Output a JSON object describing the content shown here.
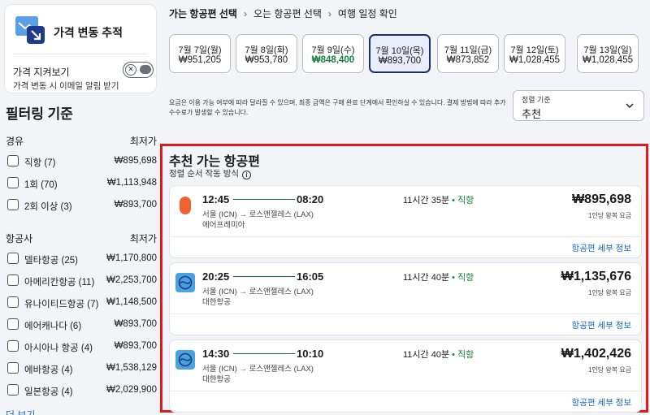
{
  "alert": {
    "title": "가격 변동 추적",
    "watch_label": "가격 지켜보기",
    "watch_sub": "가격 변동 시 이메일 알림 받기",
    "toggle_symbol": "✕"
  },
  "filters": {
    "title": "필터링 기준",
    "stops": {
      "heading": "경유",
      "price_heading": "최저가",
      "options": [
        {
          "label": "직항 (7)",
          "price": "₩895,698"
        },
        {
          "label": "1회 (70)",
          "price": "₩1,113,948"
        },
        {
          "label": "2회 이상 (3)",
          "price": "₩893,700"
        }
      ]
    },
    "airlines": {
      "heading": "항공사",
      "price_heading": "최저가",
      "options": [
        {
          "label": "델타항공 (25)",
          "price": "₩1,170,800"
        },
        {
          "label": "아메리칸항공 (11)",
          "price": "₩2,253,700"
        },
        {
          "label": "유나이티드항공 (7)",
          "price": "₩1,148,500"
        },
        {
          "label": "에어캐나다 (6)",
          "price": "₩893,700"
        },
        {
          "label": "아시아나 항공 (4)",
          "price": "₩893,700"
        },
        {
          "label": "에바항공 (4)",
          "price": "₩1,538,129"
        },
        {
          "label": "일본항공 (4)",
          "price": "₩2,029,900"
        }
      ]
    },
    "more": "더 보기"
  },
  "breadcrumb": {
    "step1": "가는 항공편 선택",
    "step2": "오는 항공편 선택",
    "step3": "여행 일정 확인",
    "sep": "›"
  },
  "dates": [
    {
      "date": "7월 7일(월)",
      "price": "₩951,205"
    },
    {
      "date": "7월 8일(화)",
      "price": "₩953,780"
    },
    {
      "date": "7월 9일(수)",
      "price": "₩848,400"
    },
    {
      "date": "7월 10일(목)",
      "price": "₩893,700"
    },
    {
      "date": "7월 11일(금)",
      "price": "₩873,852"
    },
    {
      "date": "7월 12일(토)",
      "price": "₩1,028,455"
    },
    {
      "date": "7월 13일(일)",
      "price": "₩1,028,455"
    }
  ],
  "notice": "요금은 이용 가능 여부에 따라 달라질 수 있으며, 최종 금액은 구매 완료 단계에서 확인하실 수 있습니다. 결제 방법에 따라 추가 수수료가 발생할 수 있습니다.",
  "sort": {
    "label": "정렬 기준",
    "value": "추천"
  },
  "results": {
    "title": "추천 가는 항공편",
    "howto": "정렬 순서 작동 방식",
    "flights": [
      {
        "dep": "12:45",
        "arr": "08:20",
        "route": "서울 (ICN) → 로스앤젤레스 (LAX)",
        "airline": "에어프레미아",
        "duration": "11시간 35분",
        "bullet": "•",
        "stops": "직항",
        "price": "₩895,698",
        "note": "1인당 왕복 요금",
        "detail": "항공편 세부 정보",
        "logo": "air-premia-logo",
        "color": "#f0622f"
      },
      {
        "dep": "20:25",
        "arr": "16:05",
        "route": "서울 (ICN) → 로스앤젤레스 (LAX)",
        "airline": "대한항공",
        "duration": "11시간 40분",
        "bullet": "•",
        "stops": "직항",
        "price": "₩1,135,676",
        "note": "1인당 왕복 요금",
        "detail": "항공편 세부 정보",
        "logo": "korean-air-logo",
        "color": "#4aa3dc"
      },
      {
        "dep": "14:30",
        "arr": "10:10",
        "route": "서울 (ICN) → 로스앤젤레스 (LAX)",
        "airline": "대한항공",
        "duration": "11시간 40분",
        "bullet": "•",
        "stops": "직항",
        "price": "₩1,402,426",
        "note": "1인당 왕복 요금",
        "detail": "항공편 세부 정보",
        "logo": "korean-air-logo",
        "color": "#4aa3dc"
      }
    ]
  },
  "colors": {
    "accent_green": "#15803d",
    "highlight_border": "#e01a1a",
    "link": "#1668c7",
    "selected_date_border": "#1f2f6e"
  }
}
